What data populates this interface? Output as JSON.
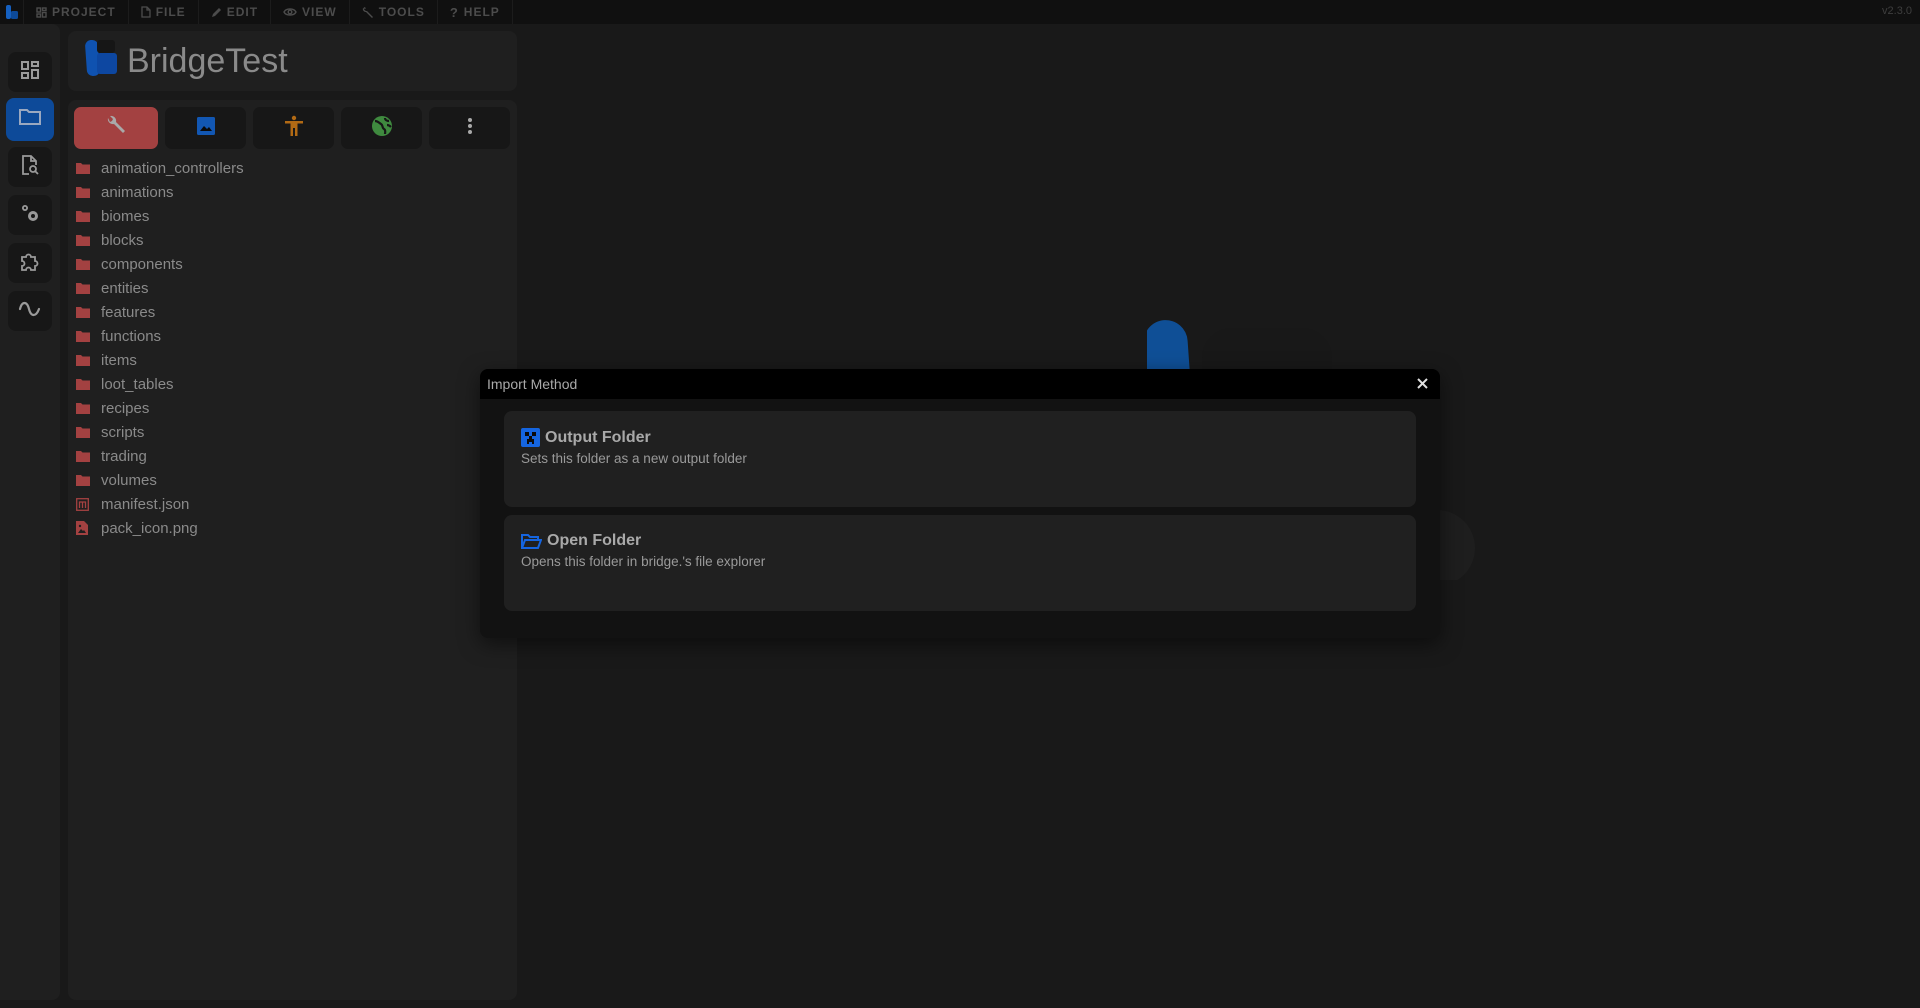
{
  "app": {
    "version": "v2.3.0",
    "logo_icon": "bridge-logo-icon"
  },
  "menubar": {
    "items": [
      {
        "label": "PROJECT",
        "icon": "dashboard-icon"
      },
      {
        "label": "FILE",
        "icon": "file-icon"
      },
      {
        "label": "EDIT",
        "icon": "pencil-icon"
      },
      {
        "label": "VIEW",
        "icon": "eye-icon"
      },
      {
        "label": "TOOLS",
        "icon": "wrench-icon"
      },
      {
        "label": "HELP",
        "icon": "question-icon"
      }
    ]
  },
  "rail": {
    "items": [
      {
        "name": "dashboard",
        "icon": "dashboard-icon",
        "active": false
      },
      {
        "name": "explorer",
        "icon": "folder-icon",
        "active": true
      },
      {
        "name": "file-search",
        "icon": "file-search-icon",
        "active": false
      },
      {
        "name": "settings",
        "icon": "cogs-icon",
        "active": false
      },
      {
        "name": "extensions",
        "icon": "puzzle-icon",
        "active": false
      },
      {
        "name": "compiler",
        "icon": "sine-wave-icon",
        "active": false
      }
    ]
  },
  "project": {
    "name": "BridgeTest",
    "tabs": [
      {
        "name": "behavior-pack",
        "icon": "wrench-icon",
        "color": "#a34141",
        "active": true
      },
      {
        "name": "resource-pack",
        "icon": "image-icon",
        "color": "#1257b3",
        "active": false
      },
      {
        "name": "skin-pack",
        "icon": "accessibility-icon",
        "color": "#b26a14",
        "active": false
      },
      {
        "name": "world",
        "icon": "globe-icon",
        "color": "#3f8a3f",
        "active": false
      },
      {
        "name": "more",
        "icon": "more-vertical-icon",
        "color": "#8a8a8a",
        "active": false
      }
    ],
    "files": [
      {
        "label": "animation_controllers",
        "type": "folder"
      },
      {
        "label": "animations",
        "type": "folder"
      },
      {
        "label": "biomes",
        "type": "folder"
      },
      {
        "label": "blocks",
        "type": "folder"
      },
      {
        "label": "components",
        "type": "folder"
      },
      {
        "label": "entities",
        "type": "folder"
      },
      {
        "label": "features",
        "type": "folder"
      },
      {
        "label": "functions",
        "type": "folder"
      },
      {
        "label": "items",
        "type": "folder"
      },
      {
        "label": "loot_tables",
        "type": "folder"
      },
      {
        "label": "recipes",
        "type": "folder"
      },
      {
        "label": "scripts",
        "type": "folder"
      },
      {
        "label": "trading",
        "type": "folder"
      },
      {
        "label": "volumes",
        "type": "folder"
      },
      {
        "label": "manifest.json",
        "type": "manifest"
      },
      {
        "label": "pack_icon.png",
        "type": "image"
      }
    ]
  },
  "dialog": {
    "title": "Import Method",
    "close_icon": "close-icon",
    "options": [
      {
        "title": "Output Folder",
        "description": "Sets this folder as a new output folder",
        "icon": "creeper-icon"
      },
      {
        "title": "Open Folder",
        "description": "Opens this folder in bridge.'s file explorer",
        "icon": "folder-open-icon"
      }
    ]
  },
  "colors": {
    "accent_blue": "#0d4a99",
    "behavior_red": "#a34141",
    "icon_blue": "#1565e0"
  }
}
